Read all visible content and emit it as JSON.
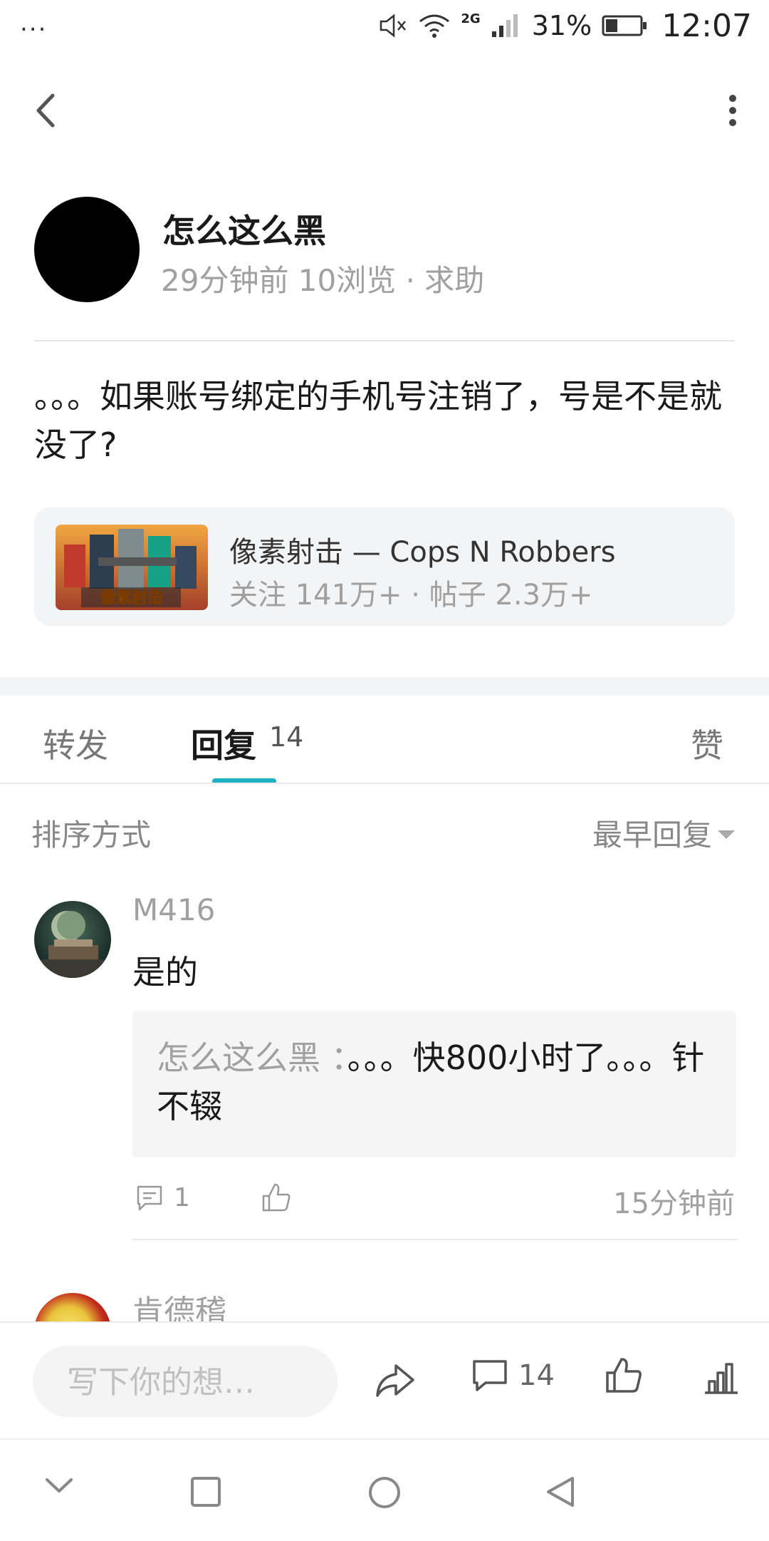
{
  "status_bar": {
    "notifications": "...",
    "network": "2G",
    "battery": "31%",
    "time": "12:07"
  },
  "header": {
    "back_icon": "back-chevron-icon",
    "more_icon": "more-vertical-icon"
  },
  "post": {
    "author": "怎么这么黑",
    "meta": "29分钟前 10浏览  ·  求助",
    "body": "。。。如果账号绑定的手机号注销了，号是不是就没了?"
  },
  "game_card": {
    "thumbnail_text": "像素射击",
    "title": "像素射击 — Cops N Robbers",
    "stats": "关注 141万+  ·  帖子 2.3万+"
  },
  "tabs": {
    "forward": "转发",
    "reply": "回复",
    "reply_count": "14",
    "like": "赞"
  },
  "sort": {
    "label": "排序方式",
    "selected": "最早回复"
  },
  "replies": [
    {
      "name": "M416",
      "text": "是的",
      "quote_author": "怎么这么黑 ：",
      "quote_text": "。。。快800小时了。。。针不辍",
      "comment_count": "1",
      "time": "15分钟前"
    },
    {
      "name": "肯德稽"
    }
  ],
  "bottom_bar": {
    "compose_placeholder": "写下你的想…",
    "reply_count": "14"
  },
  "colors": {
    "accent": "#1fb2c4",
    "muted_text": "#a0a0a0",
    "card_bg": "#f3f4f6"
  }
}
